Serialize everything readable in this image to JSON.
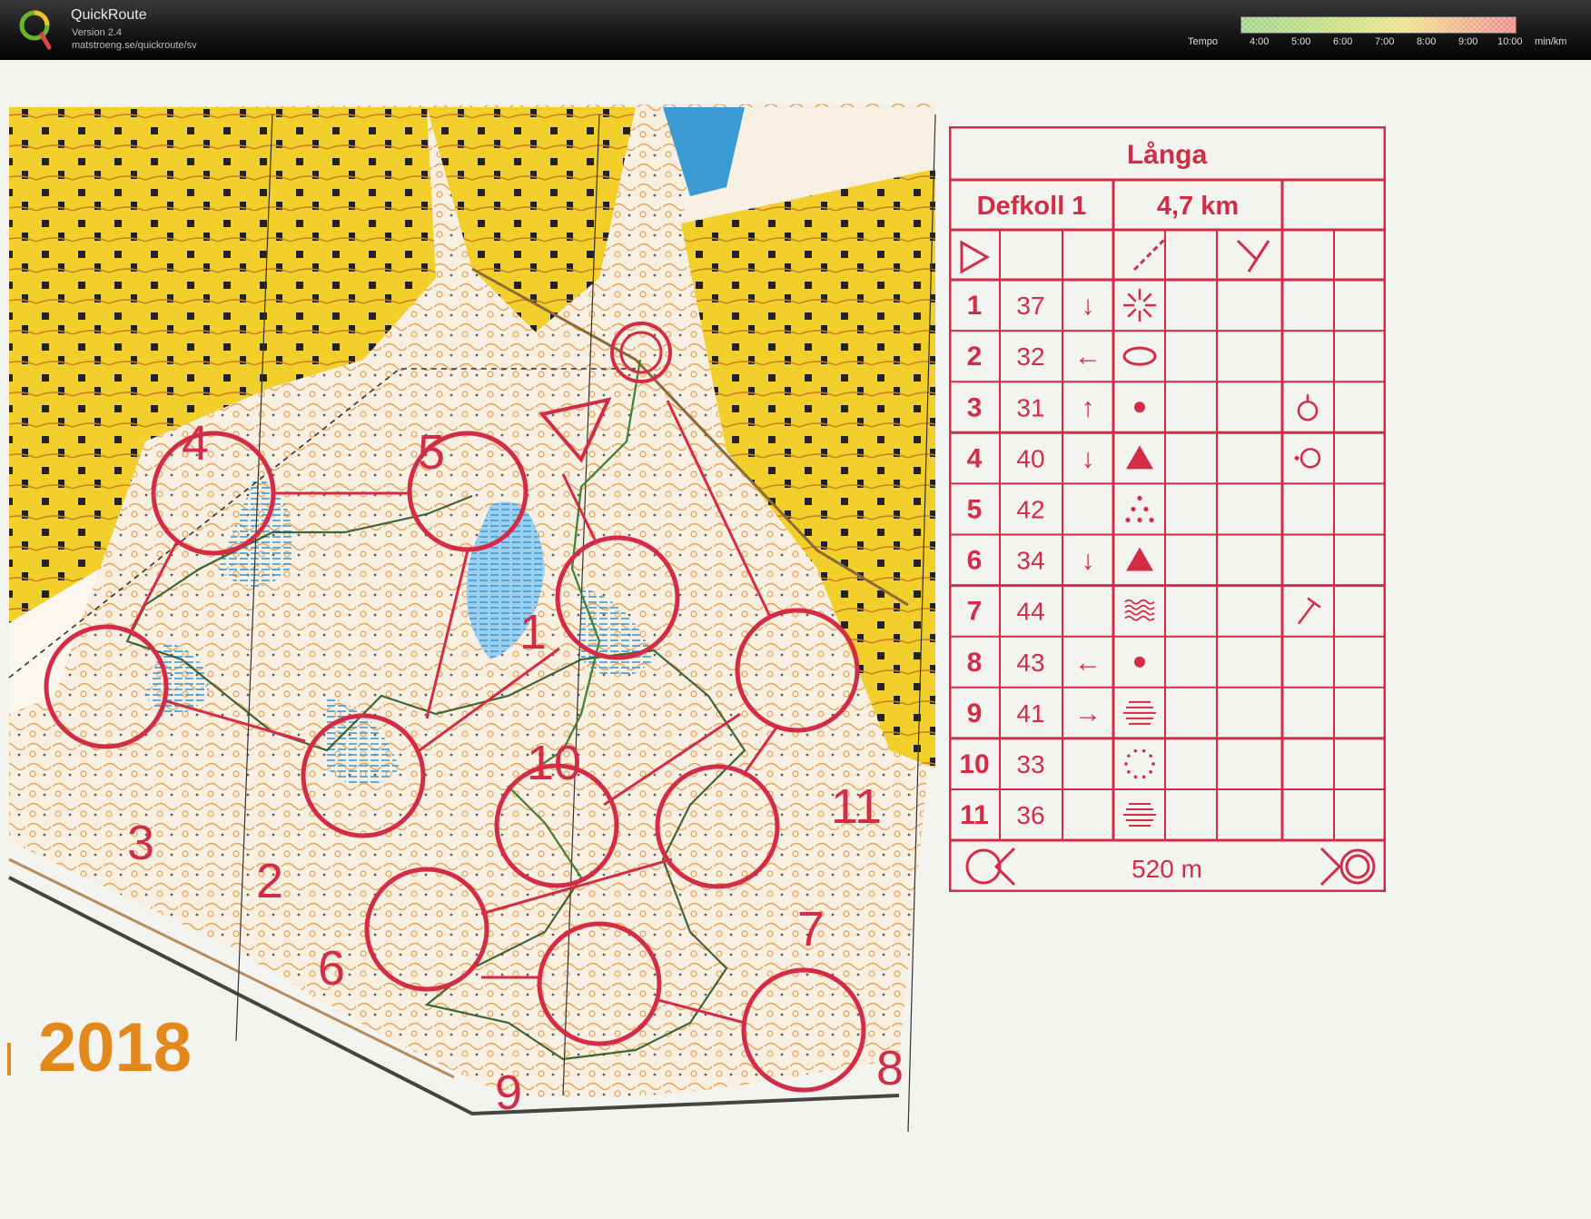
{
  "app": {
    "name": "QuickRoute",
    "version": "Version 2.4",
    "url": "matstroeng.se/quickroute/sv"
  },
  "tempo": {
    "label": "Tempo",
    "ticks": [
      "4:00",
      "5:00",
      "6:00",
      "7:00",
      "8:00",
      "9:00",
      "10:00"
    ],
    "unit": "min/km"
  },
  "colors": {
    "course": "#d42c46",
    "map_yellow": "#f2cf2a",
    "map_orange": "#e5902c",
    "paper": "#f3f3ef"
  },
  "map": {
    "year": "2018",
    "control_labels": [
      "1",
      "2",
      "3",
      "4",
      "5",
      "6",
      "7",
      "8",
      "9",
      "10",
      "11"
    ]
  },
  "card": {
    "course_name": "Långa",
    "class": "Defkoll 1",
    "length": "4,7 km",
    "finish_distance": "520 m",
    "rows": [
      {
        "num": "1",
        "code": "37",
        "dir": "↓",
        "feature": "starburst",
        "extra": ""
      },
      {
        "num": "2",
        "code": "32",
        "dir": "←",
        "feature": "ellipse",
        "extra": ""
      },
      {
        "num": "3",
        "code": "31",
        "dir": "↑",
        "feature": "dot",
        "extra": "ring-top"
      },
      {
        "num": "4",
        "code": "40",
        "dir": "↓",
        "feature": "triangle",
        "extra": "ring-left"
      },
      {
        "num": "5",
        "code": "42",
        "dir": "",
        "feature": "dotted-triangle",
        "extra": ""
      },
      {
        "num": "6",
        "code": "34",
        "dir": "↓",
        "feature": "triangle",
        "extra": ""
      },
      {
        "num": "7",
        "code": "44",
        "dir": "",
        "feature": "marsh",
        "extra": "hammer"
      },
      {
        "num": "8",
        "code": "43",
        "dir": "←",
        "feature": "dot",
        "extra": ""
      },
      {
        "num": "9",
        "code": "41",
        "dir": "→",
        "feature": "lines",
        "extra": ""
      },
      {
        "num": "10",
        "code": "33",
        "dir": "",
        "feature": "dotted-circle",
        "extra": ""
      },
      {
        "num": "11",
        "code": "36",
        "dir": "",
        "feature": "lines",
        "extra": ""
      }
    ]
  }
}
